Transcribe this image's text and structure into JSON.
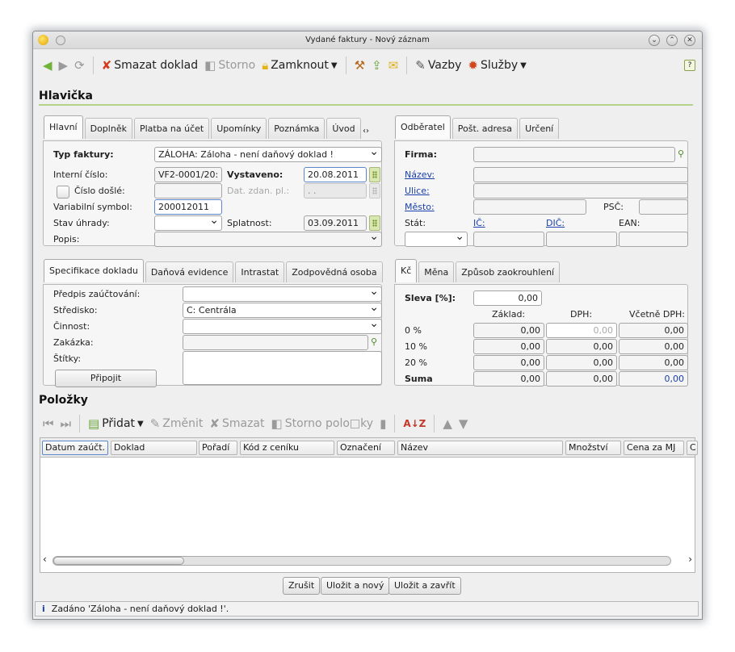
{
  "window": {
    "title": "Vydané faktury - Nový záznam"
  },
  "toolbar": {
    "delete": "Smazat doklad",
    "storno": "Storno",
    "lock": "Zamknout",
    "links": "Vazby",
    "services": "Služby"
  },
  "header": {
    "title": "Hlavička",
    "left_tabs": [
      "Hlavní",
      "Doplněk",
      "Platba na účet",
      "Upomínky",
      "Poznámka",
      "Úvod"
    ],
    "right_tabs": [
      "Odběratel",
      "Pošt. adresa",
      "Určení"
    ],
    "invoice_type_label": "Typ faktury:",
    "invoice_type_value": "ZÁLOHA: Záloha - není daňový doklad !",
    "internal_no_label": "Interní číslo:",
    "internal_no_value": "VF2-0001/20:",
    "issued_label": "Vystaveno:",
    "issued_value": "20.08.2011",
    "received_no_label": "Číslo došlé:",
    "tax_date_label": "Dat. zdan. pl.:",
    "tax_date_value": ". .",
    "var_symbol_label": "Variabilní symbol:",
    "var_symbol_value": "200012011",
    "payment_state_label": "Stav úhrady:",
    "due_label": "Splatnost:",
    "due_value": "03.09.2011",
    "desc_label": "Popis:",
    "company_label": "Firma:",
    "name_label": "Název:",
    "street_label": "Ulice:",
    "city_label": "Město:",
    "zip_label": "PSČ:",
    "country_label": "Stát:",
    "ic_label": "IČ:",
    "dic_label": "DIČ:",
    "ean_label": "EAN:"
  },
  "spec": {
    "tabs": [
      "Specifikace dokladu",
      "Daňová evidence",
      "Intrastat",
      "Zodpovědná osoba"
    ],
    "posting_label": "Předpis zaúčtování:",
    "center_label": "Středisko:",
    "center_value": "C: Centrála",
    "activity_label": "Činnost:",
    "order_label": "Zakázka:",
    "tags_label": "Štítky:",
    "attach_button": "Připojit"
  },
  "currency": {
    "tabs": [
      "Kč",
      "Měna",
      "Způsob zaokrouhlení"
    ],
    "discount_label": "Sleva [%]:",
    "discount_value": "0,00",
    "col_base": "Základ:",
    "col_vat": "DPH:",
    "col_total": "Včetně DPH:",
    "rows": [
      {
        "label": "0 %",
        "base": "0,00",
        "vat": "0,00",
        "total": "0,00"
      },
      {
        "label": "10 %",
        "base": "0,00",
        "vat": "0,00",
        "total": "0,00"
      },
      {
        "label": "20 %",
        "base": "0,00",
        "vat": "0,00",
        "total": "0,00"
      },
      {
        "label": "Suma",
        "base": "0,00",
        "vat": "0,00",
        "total": "0,00"
      }
    ]
  },
  "items": {
    "title": "Položky",
    "add": "Přidat",
    "change": "Změnit",
    "delete": "Smazat",
    "storno": "Storno polo□ky",
    "columns": [
      "Datum zaúčt.",
      "Doklad",
      "Pořadí",
      "Kód z ceníku",
      "Označení",
      "Název",
      "Množství",
      "Cena za MJ",
      "C"
    ]
  },
  "footer": {
    "cancel": "Zrušit",
    "save_new": "Uložit a nový",
    "save_close": "Uložit a zavřít",
    "status": "Zadáno 'Záloha - není daňový doklad !'."
  },
  "colors": {
    "accent_line": "#b5d28a",
    "link": "#1a3fa8",
    "focus": "#5b86c9"
  }
}
